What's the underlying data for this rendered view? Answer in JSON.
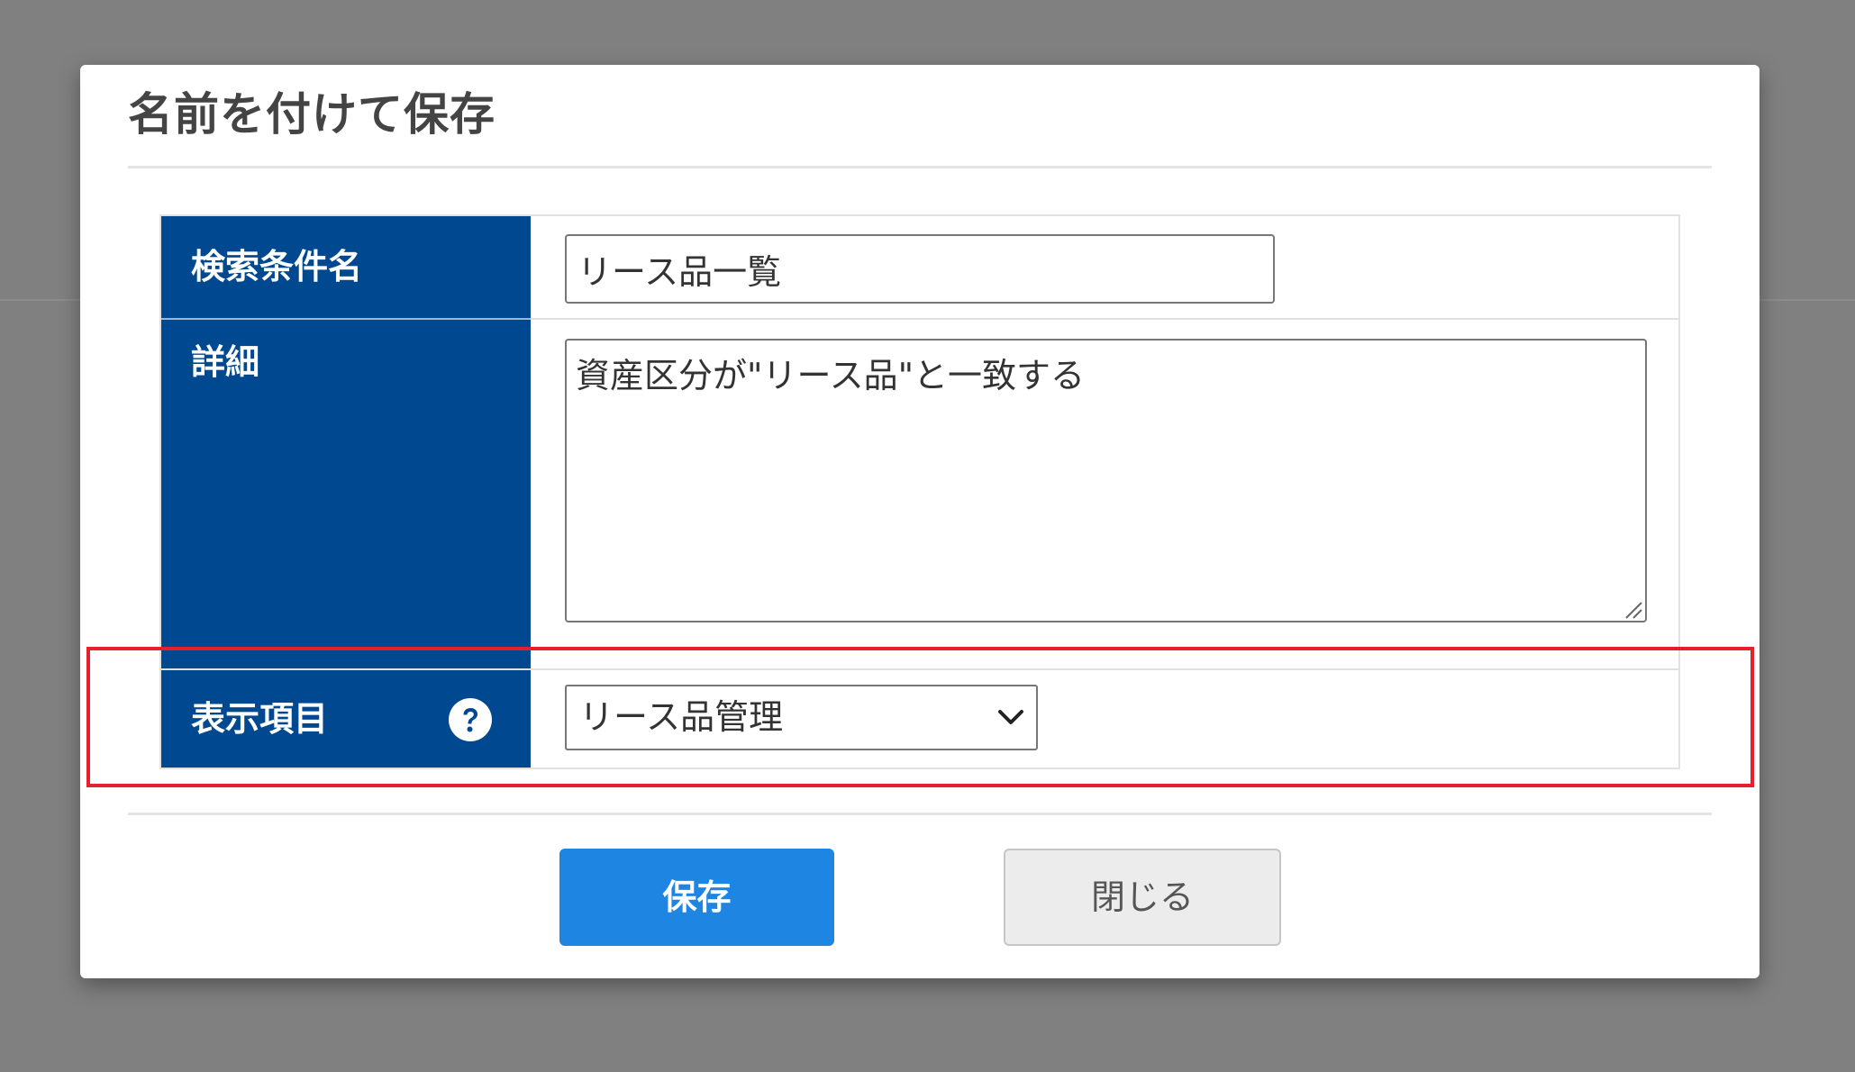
{
  "dialog": {
    "title": "名前を付けて保存"
  },
  "form": {
    "name_label": "検索条件名",
    "name_value": "リース品一覧",
    "detail_label": "詳細",
    "detail_value": "資産区分が\"リース品\"と一致する",
    "display_label": "表示項目",
    "display_selected": "リース品管理"
  },
  "buttons": {
    "save_label": "保存",
    "close_label": "閉じる"
  },
  "icons": {
    "help": "question-circle-icon",
    "dropdown": "chevron-down-icon",
    "resize": "resize-grip-icon"
  },
  "colors": {
    "label_bg": "#00488f",
    "primary_button": "#1e86e2",
    "highlight_border": "#e6202b",
    "overlay": "#808080"
  }
}
